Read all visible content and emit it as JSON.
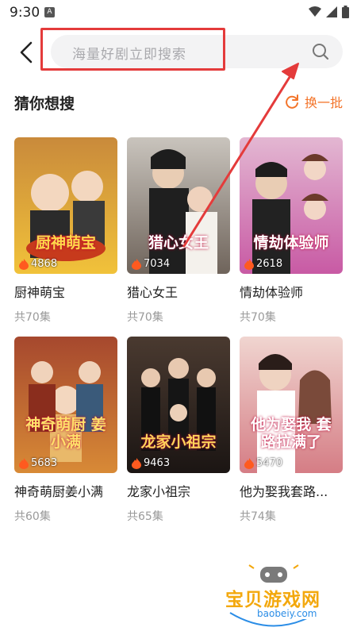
{
  "status": {
    "time": "9:30",
    "app_icon": "A"
  },
  "search": {
    "placeholder": "海量好剧立即搜索"
  },
  "section": {
    "title": "猜你想搜",
    "refresh_label": "换一批"
  },
  "cards": [
    {
      "name": "厨神萌宝",
      "poster_title": "厨神萌宝",
      "views": "4868",
      "episodes": "共70集",
      "color_top": "#c98a3b",
      "color_bottom": "#f1c23a"
    },
    {
      "name": "猎心女王",
      "poster_title": "猎心女王",
      "views": "7034",
      "episodes": "共70集",
      "color_top": "#b9b4ae",
      "color_bottom": "#6f645b"
    },
    {
      "name": "情劫体验师",
      "poster_title": "情劫体验师",
      "views": "2618",
      "episodes": "共70集",
      "color_top": "#d7a3c6",
      "color_bottom": "#c85aa4"
    },
    {
      "name": "神奇萌厨姜小满",
      "poster_title": "神奇萌厨 姜小满",
      "views": "5683",
      "episodes": "共60集",
      "color_top": "#a6482e",
      "color_bottom": "#d88a36"
    },
    {
      "name": "龙家小祖宗",
      "poster_title": "龙家小祖宗",
      "views": "9463",
      "episodes": "共65集",
      "color_top": "#3c2e27",
      "color_bottom": "#1b1513"
    },
    {
      "name": "他为娶我套路...",
      "poster_title": "他为娶我 套路拉满了",
      "views": "5470",
      "episodes": "共74集",
      "color_top": "#e8c9c4",
      "color_bottom": "#d57d85"
    }
  ],
  "watermark": {
    "text": "宝贝游戏网",
    "url": "baobeiy.com"
  },
  "colors": {
    "accent": "#f3742a",
    "annotation_red": "#e43b3b",
    "watermark": "#f3a80d"
  }
}
